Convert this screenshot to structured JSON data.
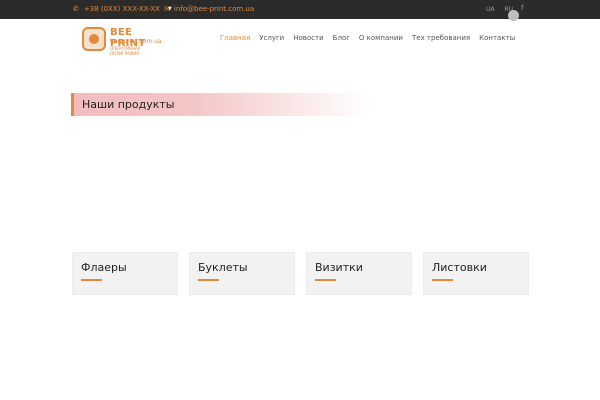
{
  "topbar": {
    "phone_icon": "phone-icon",
    "phone": "+38 (0XX) XXX-XX-XX",
    "email_icon": "envelope-icon",
    "email": "info@bee-print.com.ua",
    "lang_ua": "UA",
    "lang_ru": "RU",
    "facebook_icon": "facebook-icon"
  },
  "logo": {
    "name": "BEE PRINT",
    "domain": "bee-print.com.ua",
    "tagline": "ОПЕРАТИВНАЯ ПОЛИГРАФИЯ"
  },
  "nav": {
    "items": [
      {
        "label": "Главная"
      },
      {
        "label": "Услуги"
      },
      {
        "label": "Новости"
      },
      {
        "label": "Блог"
      },
      {
        "label": "О компании"
      },
      {
        "label": "Тех требования"
      },
      {
        "label": "Контакты"
      }
    ]
  },
  "main": {
    "section_title": "Наши продукты",
    "products": [
      {
        "label": "Флаеры"
      },
      {
        "label": "Буклеты"
      },
      {
        "label": "Визитки"
      },
      {
        "label": "Листовки"
      }
    ]
  },
  "colors": {
    "accent": "#e08a3c",
    "topbar_bg": "#2b2b2b",
    "card_bg": "#f2f2f2"
  }
}
